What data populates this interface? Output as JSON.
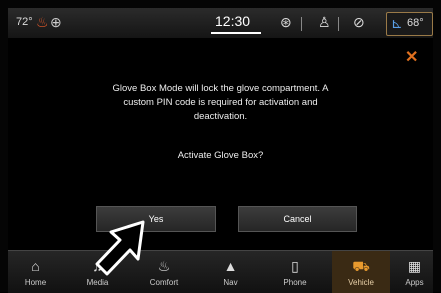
{
  "status": {
    "left_temp": "72°",
    "time": "12:30",
    "right_temp": "68°"
  },
  "dialog": {
    "message": "Glove Box Mode will lock the glove compartment. A custom PIN code is required for activation and deactivation.",
    "question": "Activate Glove Box?",
    "yes_label": "Yes",
    "cancel_label": "Cancel",
    "close_icon": "close-icon"
  },
  "nav": {
    "items": [
      {
        "label": "Home",
        "icon": "home-icon"
      },
      {
        "label": "Media",
        "icon": "music-note-icon"
      },
      {
        "label": "Comfort",
        "icon": "seat-icon"
      },
      {
        "label": "Nav",
        "icon": "navigation-arrow-icon"
      },
      {
        "label": "Phone",
        "icon": "phone-icon"
      },
      {
        "label": "Vehicle",
        "icon": "car-icon"
      },
      {
        "label": "Apps",
        "icon": "apps-grid-icon"
      }
    ],
    "active": "Vehicle"
  },
  "colors": {
    "accent": "#e0701f",
    "active_nav_bg": "#3a2a14"
  }
}
